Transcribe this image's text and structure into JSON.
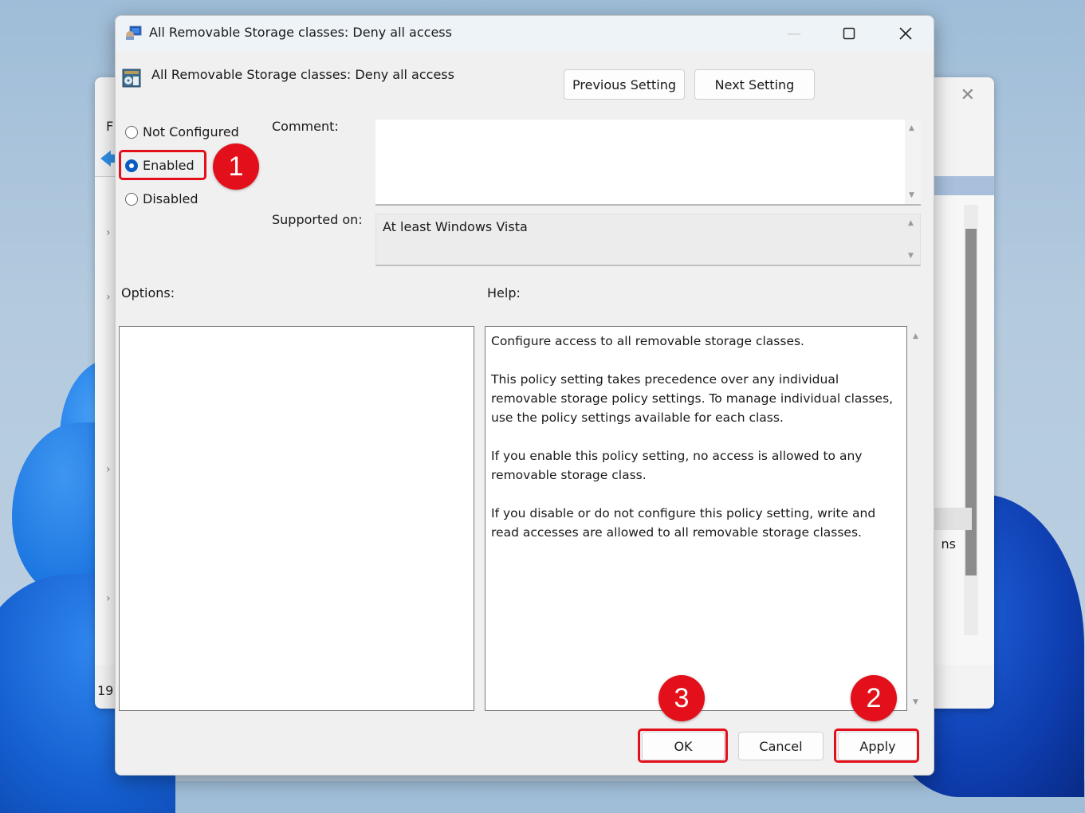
{
  "background_window": {
    "menu_letter": "F",
    "partial_text_right": "ns",
    "status_text": "19",
    "close_icon": "close-icon",
    "back_icon": "back-arrow-icon"
  },
  "dialog": {
    "title": "All Removable Storage classes: Deny all access",
    "window_controls": {
      "minimize": "minimize-icon",
      "maximize": "maximize-icon",
      "close": "close-icon"
    },
    "setting_title": "All Removable Storage classes: Deny all access",
    "nav": {
      "previous_label": "Previous Setting",
      "next_label": "Next Setting"
    },
    "state": {
      "options": [
        {
          "label": "Not Configured",
          "checked": false
        },
        {
          "label": "Enabled",
          "checked": true
        },
        {
          "label": "Disabled",
          "checked": false
        }
      ],
      "selected": "Enabled"
    },
    "comment": {
      "label": "Comment:",
      "value": ""
    },
    "supported_on": {
      "label": "Supported on:",
      "value": "At least Windows Vista"
    },
    "options_label": "Options:",
    "help_label": "Help:",
    "help_paragraphs": [
      "Configure access to all removable storage classes.",
      "This policy setting takes precedence over any individual removable storage policy settings. To manage individual classes, use the policy settings available for each class.",
      "If you enable this policy setting, no access is allowed to any removable storage class.",
      "If you disable or do not configure this policy setting, write and read accesses are allowed to all removable storage classes."
    ],
    "footer": {
      "ok_label": "OK",
      "cancel_label": "Cancel",
      "apply_label": "Apply"
    }
  },
  "annotations": {
    "step_1": "1",
    "step_2": "2",
    "step_3": "3",
    "highlight_color": "#e3101b"
  },
  "colors": {
    "accent": "#0a5cc2",
    "annotation_red": "#e3101b"
  }
}
